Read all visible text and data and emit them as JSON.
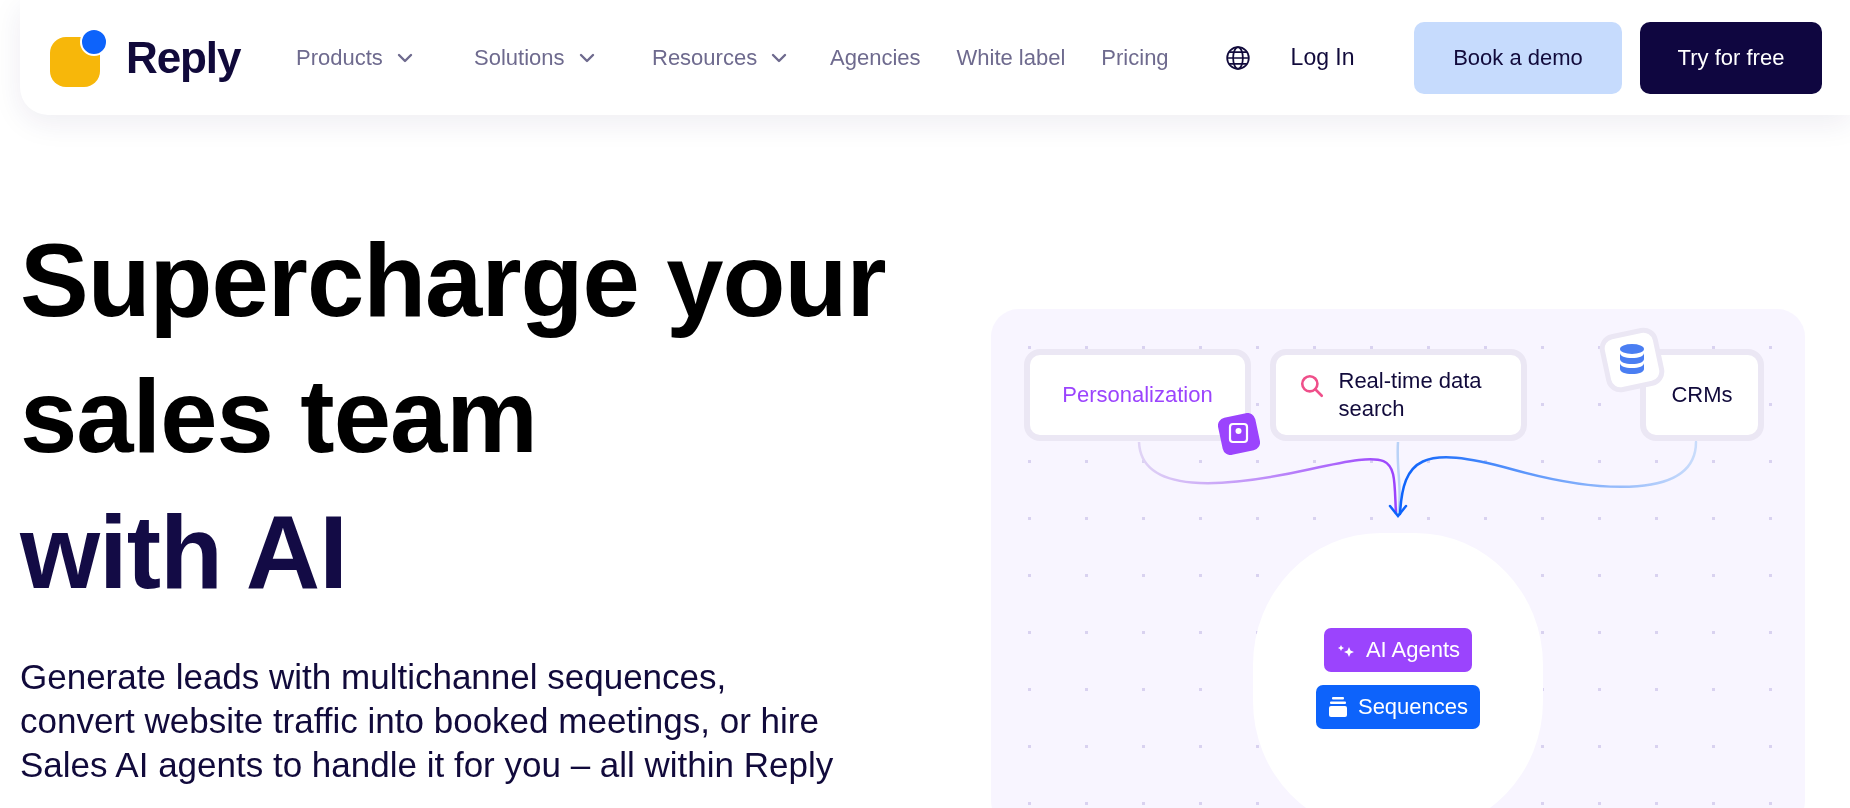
{
  "nav": {
    "logo": "Reply",
    "items": [
      {
        "label": "Products",
        "dropdown": true
      },
      {
        "label": "Solutions",
        "dropdown": true
      },
      {
        "label": "Resources",
        "dropdown": true
      },
      {
        "label": "Agencies",
        "dropdown": false
      },
      {
        "label": "White label",
        "dropdown": false
      },
      {
        "label": "Pricing",
        "dropdown": false
      }
    ],
    "login": "Log In",
    "buttons": [
      {
        "label": "Book a demo",
        "kind": "secondary"
      },
      {
        "label": "Try for free",
        "kind": "primary"
      }
    ]
  },
  "hero": {
    "heading": [
      {
        "text": "Supercharge your",
        "accent": false
      },
      {
        "text": "sales team",
        "accent": false
      },
      {
        "text": "with AI",
        "accent": true
      }
    ],
    "text": "Generate leads with multichannel sequences, convert website traffic into booked meetings, or hire Sales AI agents to handle it for you – all within Reply"
  },
  "diagram": {
    "sources": [
      {
        "label": "Personalization",
        "kind": "personalization"
      },
      {
        "label": "Real-time data search",
        "kind": "search"
      },
      {
        "label": "CRMs",
        "kind": "crm"
      }
    ],
    "tags": [
      {
        "label": "AI Agents",
        "kind": "agents",
        "color": "#9b44fd"
      },
      {
        "label": "Sequences",
        "kind": "sequences",
        "color": "#0d63fb"
      }
    ]
  }
}
